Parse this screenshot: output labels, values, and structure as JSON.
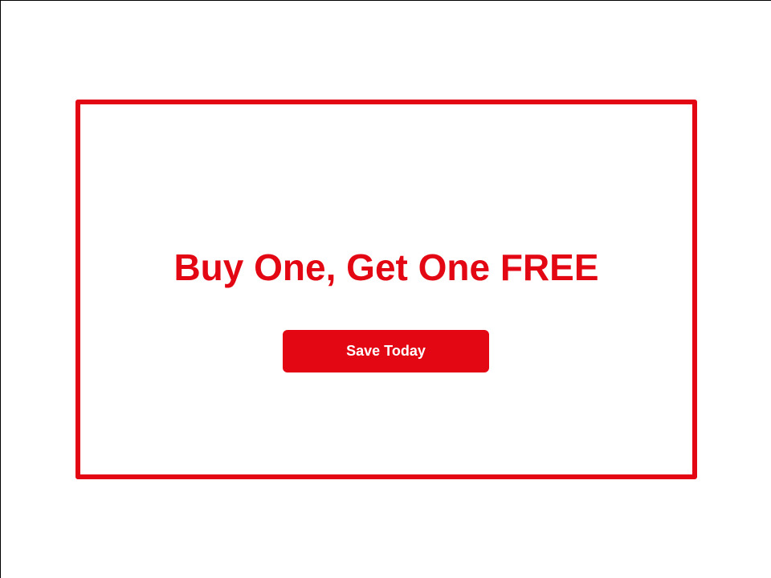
{
  "promo": {
    "headline": "Buy One, Get One FREE",
    "cta_label": "Save Today"
  },
  "colors": {
    "accent": "#e30613",
    "background": "#ffffff",
    "button_text": "#ffffff"
  }
}
